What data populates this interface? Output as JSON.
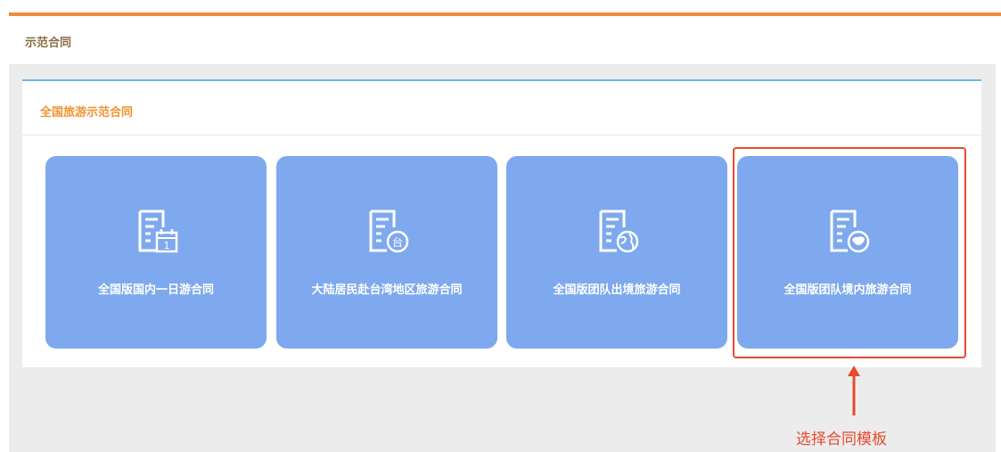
{
  "header": {
    "title": "示范合同"
  },
  "panel": {
    "title": "全国旅游示范合同"
  },
  "cards": [
    {
      "label": "全国版国内一日游合同",
      "icon": "contract-calendar-icon"
    },
    {
      "label": "大陆居民赴台湾地区旅游合同",
      "icon": "contract-taiwan-icon"
    },
    {
      "label": "全国版团队出境旅游合同",
      "icon": "contract-globe-icon"
    },
    {
      "label": "全国版团队境内旅游合同",
      "icon": "contract-china-map-icon"
    }
  ],
  "icon_overlays": {
    "calendar_day": "1",
    "taiwan_char": "台"
  },
  "annotation": {
    "text": "选择合同模板"
  },
  "colors": {
    "accent_orange": "#f58a3c",
    "card_blue": "#7ea9ee",
    "panel_title": "#f0922f",
    "panel_border": "#6fb7e6",
    "annotation_red": "#e84a2e"
  }
}
